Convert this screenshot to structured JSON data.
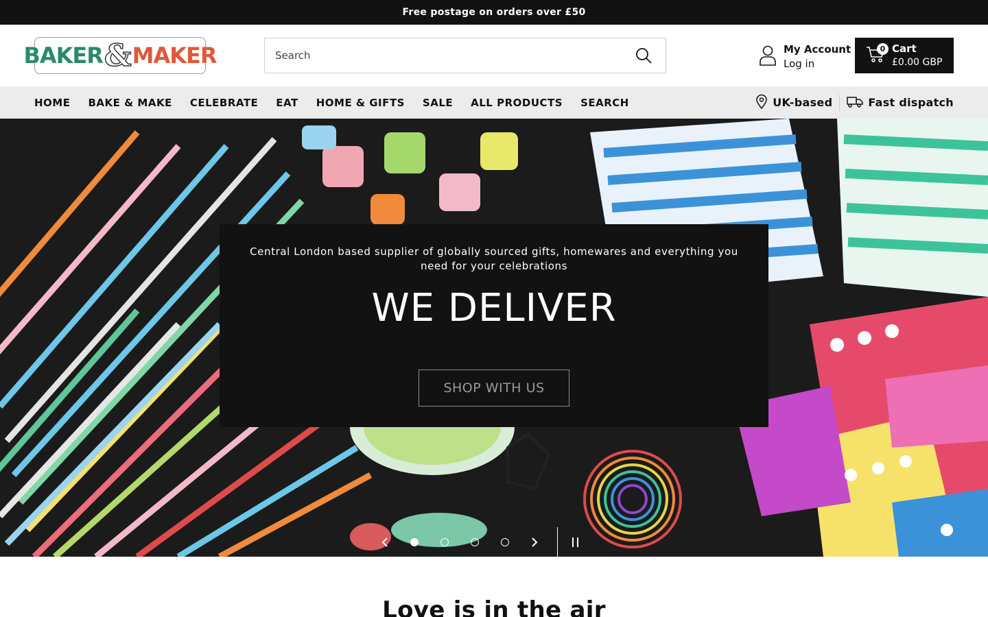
{
  "announcement": {
    "text": "Free postage on orders over £50"
  },
  "header": {
    "logo": {
      "word1": "BAKER",
      "amp": "&",
      "word2": "MAKER"
    },
    "search": {
      "placeholder": "Search"
    },
    "account": {
      "title": "My Account",
      "subtitle": "Log in"
    },
    "cart": {
      "count": "0",
      "label": "Cart",
      "total": "£0.00 GBP"
    }
  },
  "nav": {
    "items": [
      "HOME",
      "BAKE & MAKE",
      "CELEBRATE",
      "EAT",
      "HOME & GIFTS",
      "SALE",
      "ALL PRODUCTS",
      "SEARCH"
    ],
    "features": [
      {
        "label": "UK-based",
        "icon": "location-pin-icon"
      },
      {
        "label": "Fast dispatch",
        "icon": "delivery-truck-icon"
      }
    ]
  },
  "hero": {
    "subtitle": "Central London based supplier of globally sourced gifts, homewares and everything you need for your celebrations",
    "heading": "WE DELIVER",
    "button": "SHOP WITH US",
    "slides_total": 4,
    "active_slide": 1
  },
  "section": {
    "title": "Love is in the air"
  },
  "colors": {
    "dark": "#121212",
    "nav_bg": "#ececec",
    "logo_green": "#2b8a6a",
    "logo_orange": "#e0583a"
  }
}
